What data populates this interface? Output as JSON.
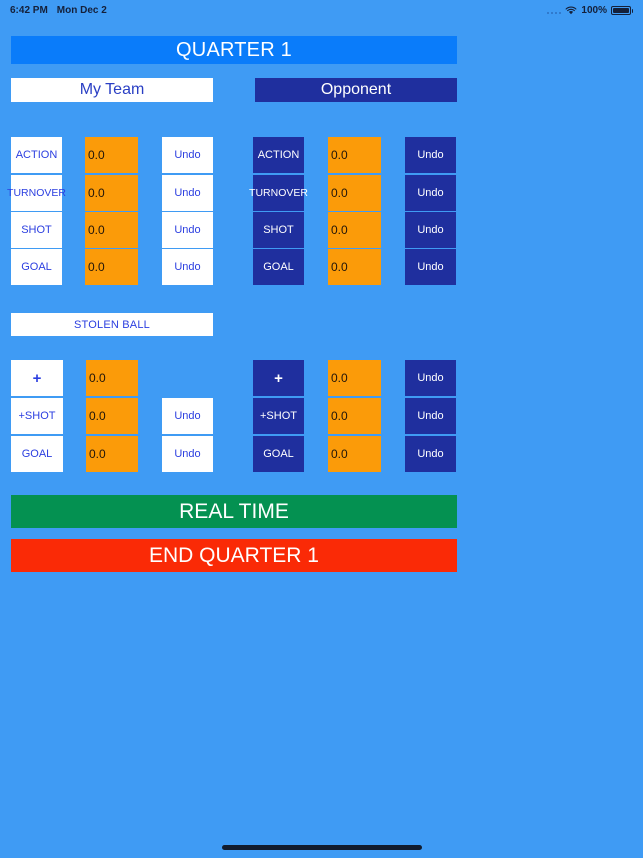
{
  "statusbar": {
    "time": "6:42 PM",
    "date": "Mon Dec 2",
    "battery_percent": "100%",
    "icons": {
      "cellular": "signal-dots-icon",
      "wifi": "wifi-icon",
      "battery": "battery-icon"
    }
  },
  "header": {
    "quarter_title": "QUARTER 1",
    "my_team_label": "My Team",
    "opponent_label": "Opponent"
  },
  "main_section": {
    "rows": [
      {
        "label": "ACTION",
        "value": "0.0",
        "undo": "Undo"
      },
      {
        "label": "TURNOVER",
        "value": "0.0",
        "undo": "Undo"
      },
      {
        "label": "SHOT",
        "value": "0.0",
        "undo": "Undo"
      },
      {
        "label": "GOAL",
        "value": "0.0",
        "undo": "Undo"
      }
    ],
    "opponent_rows": [
      {
        "label": "ACTION",
        "value": "0.0",
        "undo": "Undo"
      },
      {
        "label": "TURNOVER",
        "value": "0.0",
        "undo": "Undo"
      },
      {
        "label": "SHOT",
        "value": "0.0",
        "undo": "Undo"
      },
      {
        "label": "GOAL",
        "value": "0.0",
        "undo": "Undo"
      }
    ]
  },
  "stolen_ball_section": {
    "title": "STOLEN BALL",
    "rows": [
      {
        "label": "+",
        "value": "0.0",
        "undo": ""
      },
      {
        "label": "+SHOT",
        "value": "0.0",
        "undo": "Undo"
      },
      {
        "label": "GOAL",
        "value": "0.0",
        "undo": "Undo"
      }
    ],
    "opponent_rows": [
      {
        "label": "+",
        "value": "0.0",
        "undo": "Undo"
      },
      {
        "label": "+SHOT",
        "value": "0.0",
        "undo": "Undo"
      },
      {
        "label": "GOAL",
        "value": "0.0",
        "undo": "Undo"
      }
    ]
  },
  "footer": {
    "real_time_label": "REAL TIME",
    "end_quarter_label": "END QUARTER 1"
  },
  "colors": {
    "background": "#3f9bf4",
    "header_blue": "#0a7cfa",
    "navy": "#1f2f9e",
    "orange": "#fb9b09",
    "green": "#049151",
    "red": "#fa2a06",
    "white": "#ffffff",
    "link_blue": "#2b3ee0"
  }
}
